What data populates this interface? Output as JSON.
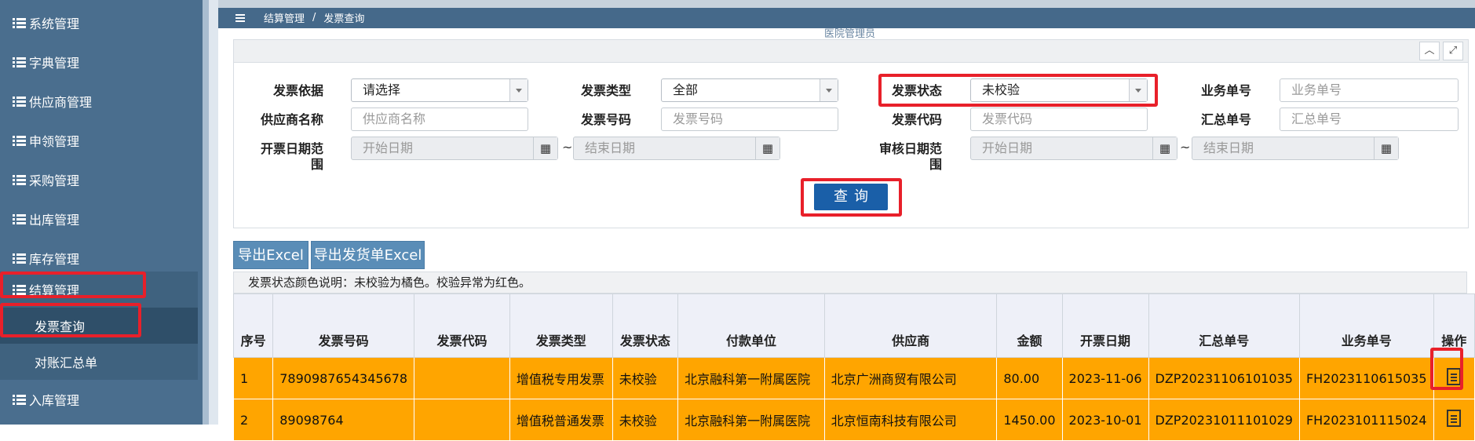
{
  "sidebar": {
    "items": [
      {
        "label": "系统管理"
      },
      {
        "label": "字典管理"
      },
      {
        "label": "供应商管理"
      },
      {
        "label": "申领管理"
      },
      {
        "label": "采购管理"
      },
      {
        "label": "出库管理"
      },
      {
        "label": "库存管理"
      },
      {
        "label": "结算管理"
      }
    ],
    "sub_items": [
      {
        "label": "发票查询"
      },
      {
        "label": "对账汇总单"
      }
    ],
    "after_item": {
      "label": "入库管理"
    }
  },
  "breadcrumb": {
    "parent": "结算管理",
    "separator": "/",
    "current": "发票查询"
  },
  "header": {
    "partial_user_text": "医院管理员"
  },
  "panel": {
    "collapse_icon": "chevron-up-icon",
    "expand_icon": "expand-icon"
  },
  "form": {
    "invoice_basis": {
      "label": "发票依据",
      "value": "请选择"
    },
    "invoice_type": {
      "label": "发票类型",
      "value": "全部"
    },
    "invoice_status": {
      "label": "发票状态",
      "value": "未校验"
    },
    "business_no": {
      "label": "业务单号",
      "placeholder": "业务单号"
    },
    "supplier_name": {
      "label": "供应商名称",
      "placeholder": "供应商名称"
    },
    "invoice_no": {
      "label": "发票号码",
      "placeholder": "发票号码"
    },
    "invoice_code": {
      "label": "发票代码",
      "placeholder": "发票代码"
    },
    "summary_no": {
      "label": "汇总单号",
      "placeholder": "汇总单号"
    },
    "issue_date": {
      "label_line1": "开票日期范",
      "label_line2": "围",
      "start_placeholder": "开始日期",
      "end_placeholder": "结束日期",
      "tilde": "~"
    },
    "audit_date": {
      "label_line1": "审核日期范",
      "label_line2": "围",
      "start_placeholder": "开始日期",
      "end_placeholder": "结束日期",
      "tilde": "~"
    },
    "query_button": "查询"
  },
  "toolbar": {
    "export_excel": "导出Excel",
    "export_delivery_excel": "导出发货单Excel"
  },
  "legend_text": "发票状态颜色说明：未校验为橘色。校验异常为红色。",
  "row_colors": {
    "unverified": "#ffa500",
    "abnormal": "#e8202a"
  },
  "table": {
    "headers": [
      "序号",
      "发票号码",
      "发票代码",
      "发票类型",
      "发票状态",
      "付款单位",
      "供应商",
      "金额",
      "开票日期",
      "汇总单号",
      "业务单号",
      "操作"
    ],
    "rows": [
      [
        "1",
        "7890987654345678",
        "",
        "增值税专用发票",
        "未校验",
        "北京融科第一附属医院",
        "北京广洲商贸有限公司",
        "80.00",
        "2023-11-06",
        "DZP20231106101035",
        "FH2023110615035"
      ],
      [
        "2",
        "89098764",
        "",
        "增值税普通发票",
        "未校验",
        "北京融科第一附属医院",
        "北京恒南科技有限公司",
        "1450.00",
        "2023-10-01",
        "DZP20231011101029",
        "FH2023101115024"
      ]
    ]
  }
}
